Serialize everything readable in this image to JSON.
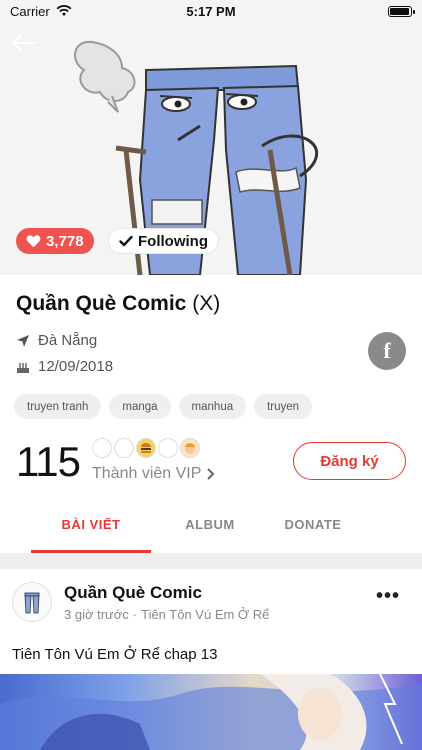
{
  "status_bar": {
    "carrier": "Carrier",
    "time": "5:17 PM",
    "battery_level": 0.95
  },
  "cover": {
    "likes": "3,778",
    "following_label": "Following"
  },
  "profile": {
    "name": "Quần Què Comic",
    "name_suffix": "(X)",
    "location": "Đà Nẵng",
    "date": "12/09/2018",
    "facebook_icon": "f"
  },
  "tags": [
    "truyen tranh",
    "manga",
    "manhua",
    "truyen"
  ],
  "members": {
    "count": "115",
    "vip_label": "Thành viên VIP",
    "register_label": "Đăng ký"
  },
  "tabs": [
    {
      "label": "BÀI VIẾT",
      "active": true
    },
    {
      "label": "ALBUM",
      "active": false
    },
    {
      "label": "DONATE",
      "active": false
    }
  ],
  "post": {
    "author": "Quần Què Comic",
    "time": "3 giờ trước",
    "separator": "·",
    "series": "Tiên Tôn Vú Em Ở Rể",
    "more": "•••",
    "text": "Tiên Tôn Vú Em Ở Rể chap 13"
  },
  "colors": {
    "accent": "#e53935",
    "like_badge": "#ef5350"
  }
}
